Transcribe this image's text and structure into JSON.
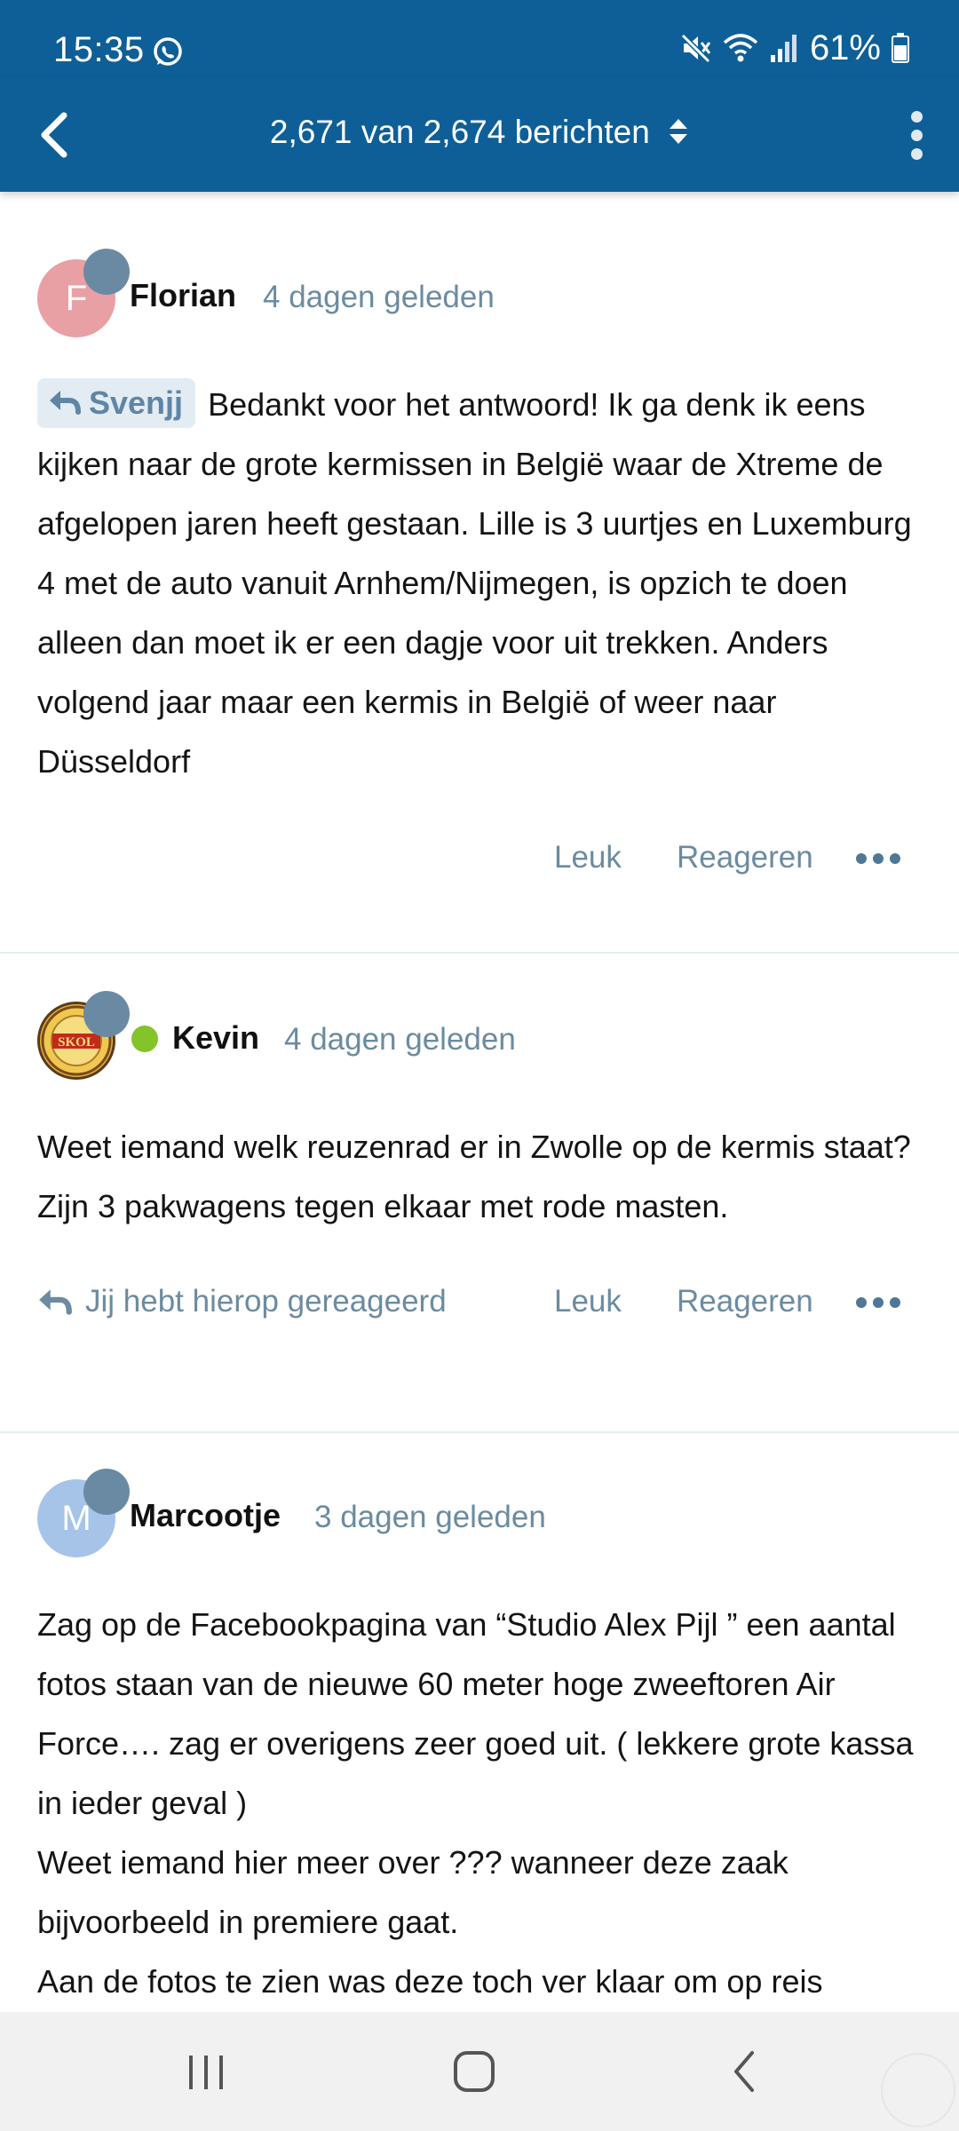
{
  "status_bar": {
    "time": "15:35",
    "battery": "61%",
    "icons": [
      "whatsapp-icon",
      "mute-icon",
      "wifi-icon",
      "signal-icon",
      "battery-icon"
    ]
  },
  "header": {
    "title": "2,671 van 2,674 berichten",
    "icons": [
      "back-arrow-icon",
      "sort-chevrons-icon",
      "kebab-menu-icon"
    ]
  },
  "posts": [
    {
      "author": "Florian",
      "avatar_letter": "F",
      "avatar_color": "#e8a0a4",
      "time": "4 dagen geleden",
      "quote_chip": "Svenjj",
      "body": "Bedankt voor het antwoord! Ik ga denk ik eens kijken naar de grote kermissen in België waar de Xtreme de afgelopen jaren heeft gestaan. Lille is 3 uurtjes en Luxemburg 4 met de auto vanuit Arnhem/Nijmegen, is opzich te doen alleen dan moet ik er een dagje voor uit trekken. Anders volgend jaar maar een kermis in België of weer naar Düsseldorf",
      "like_label": "Leuk",
      "reply_label": "Reageren"
    },
    {
      "author": "Kevin",
      "avatar_text": "SKOL",
      "time": "4 dagen geleden",
      "online": true,
      "body": "Weet iemand welk reuzenrad er in Zwolle op de kermis staat? Zijn 3 pakwagens tegen elkaar met rode masten.",
      "replied_label": "Jij hebt hierop gereageerd",
      "like_label": "Leuk",
      "reply_label": "Reageren"
    },
    {
      "author": "Marcootje",
      "avatar_letter": "M",
      "avatar_color": "#a5c4e8",
      "time": "3 dagen geleden",
      "body": "Zag op de Facebookpagina van “Studio Alex Pijl ” een aantal fotos staan van de nieuwe 60 meter hoge zweeftoren Air Force…. zag er overigens zeer goed uit. ( lekkere grote kassa in ieder geval )\nWeet iemand hier meer over ??? wanneer deze zaak bijvoorbeeld in premiere gaat.\nAan de fotos te zien was deze toch ver klaar om op reis"
    }
  ],
  "colors": {
    "header_bg": "#0e5f97",
    "accent_text": "#6b8ba0",
    "badge": "#6a8aa4",
    "online": "#82c42a"
  },
  "nav_bar": {
    "icons": [
      "recent-apps-icon",
      "home-icon",
      "back-icon"
    ]
  }
}
